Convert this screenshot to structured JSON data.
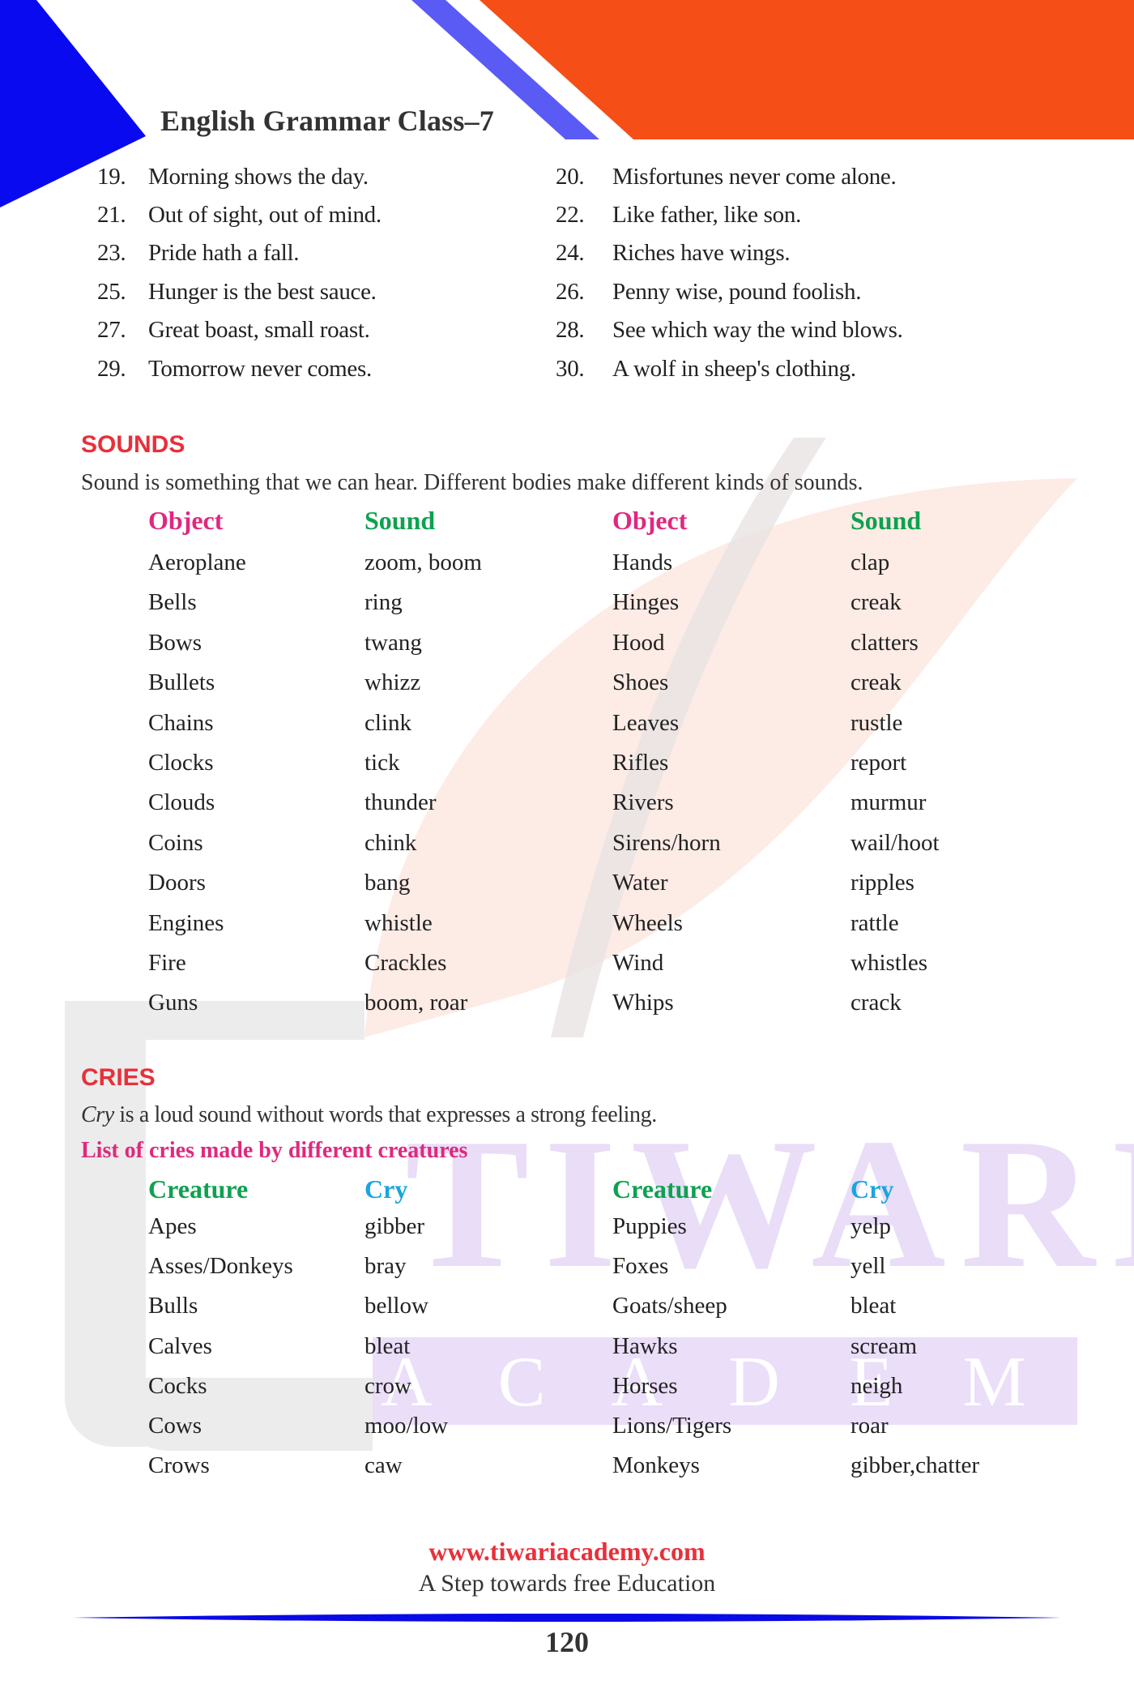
{
  "header": {
    "title": "English Grammar Class–7",
    "colors": {
      "blue": "#0a0af0",
      "stripe": "#5a5af5",
      "orange": "#f54e16"
    }
  },
  "proverbs": [
    {
      "num": "19.",
      "text": "Morning shows the day."
    },
    {
      "num": "20.",
      "text": "Misfortunes never come alone."
    },
    {
      "num": "21.",
      "text": "Out of sight, out of mind."
    },
    {
      "num": "22.",
      "text": "Like father, like son."
    },
    {
      "num": "23.",
      "text": "Pride hath a fall."
    },
    {
      "num": "24.",
      "text": "Riches have wings."
    },
    {
      "num": "25.",
      "text": "Hunger is the best sauce."
    },
    {
      "num": "26.",
      "text": "Penny wise, pound foolish."
    },
    {
      "num": "27.",
      "text": "Great boast, small roast."
    },
    {
      "num": "28.",
      "text": "See which way the wind blows."
    },
    {
      "num": "29.",
      "text": "Tomorrow never comes."
    },
    {
      "num": "30.",
      "text": "A wolf in sheep's clothing."
    }
  ],
  "sounds": {
    "heading": "SOUNDS",
    "description": "Sound is something that we can hear. Different bodies make different kinds of sounds.",
    "headers": [
      "Object",
      "Sound",
      "Object",
      "Sound"
    ],
    "rows": [
      [
        "Aeroplane",
        "zoom, boom",
        "Hands",
        "clap"
      ],
      [
        "Bells",
        "ring",
        "Hinges",
        "creak"
      ],
      [
        "Bows",
        "twang",
        "Hood",
        "clatters"
      ],
      [
        "Bullets",
        "whizz",
        "Shoes",
        "creak"
      ],
      [
        "Chains",
        "clink",
        "Leaves",
        "rustle"
      ],
      [
        "Clocks",
        "tick",
        "Rifles",
        "report"
      ],
      [
        "Clouds",
        "thunder",
        "Rivers",
        "murmur"
      ],
      [
        "Coins",
        "chink",
        "Sirens/horn",
        "wail/hoot"
      ],
      [
        "Doors",
        "bang",
        "Water",
        "ripples"
      ],
      [
        "Engines",
        "whistle",
        "Wheels",
        "rattle"
      ],
      [
        "Fire",
        "Crackles",
        "Wind",
        "whistles"
      ],
      [
        "Guns",
        "boom, roar",
        "Whips",
        "crack"
      ]
    ]
  },
  "cries": {
    "heading": "CRIES",
    "description_italic": "Cry",
    "description_rest": " is a loud sound without words that expresses a strong feeling.",
    "subheading": "List of cries made by different creatures",
    "headers": [
      "Creature",
      "Cry",
      "Creature",
      "Cry"
    ],
    "rows": [
      [
        "Apes",
        "gibber",
        "Puppies",
        "yelp"
      ],
      [
        "Asses/Donkeys",
        "bray",
        "Foxes",
        "yell"
      ],
      [
        "Bulls",
        "bellow",
        "Goats/sheep",
        "bleat"
      ],
      [
        "Calves",
        "bleat",
        "Hawks",
        "scream"
      ],
      [
        "Cocks",
        "crow",
        "Horses",
        "neigh"
      ],
      [
        "Cows",
        "moo/low",
        "Lions/Tigers",
        "roar"
      ],
      [
        "Crows",
        "caw",
        "Monkeys",
        "gibber,chatter"
      ]
    ]
  },
  "watermark": {
    "word1": "TIWARI",
    "word2": "A C A D E M Y"
  },
  "footer": {
    "url": "www.tiwariacademy.com",
    "tagline": "A Step towards free Education",
    "page_number": "120"
  }
}
